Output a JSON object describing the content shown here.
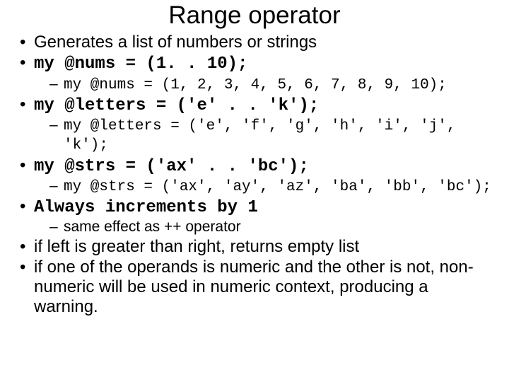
{
  "title": "Range operator",
  "bullets": {
    "b1": "Generates a list of numbers or strings",
    "b2": "my @nums = (1. . 10);",
    "b2a": "my @nums = (1, 2, 3, 4, 5, 6, 7, 8, 9, 10);",
    "b3": "my @letters = ('e' . . 'k');",
    "b3a": "my @letters = ('e', 'f', 'g', 'h', 'i', 'j', 'k');",
    "b4": "my @strs = ('ax' . . 'bc');",
    "b4a": "my @strs = ('ax', 'ay', 'az', 'ba', 'bb', 'bc');",
    "b5": "Always increments by 1",
    "b5a": "same effect as ++ operator",
    "b6": "if left is greater than right, returns empty list",
    "b7": "if one of the operands is numeric and the other is not, non-numeric will be used in numeric context, producing a warning."
  }
}
